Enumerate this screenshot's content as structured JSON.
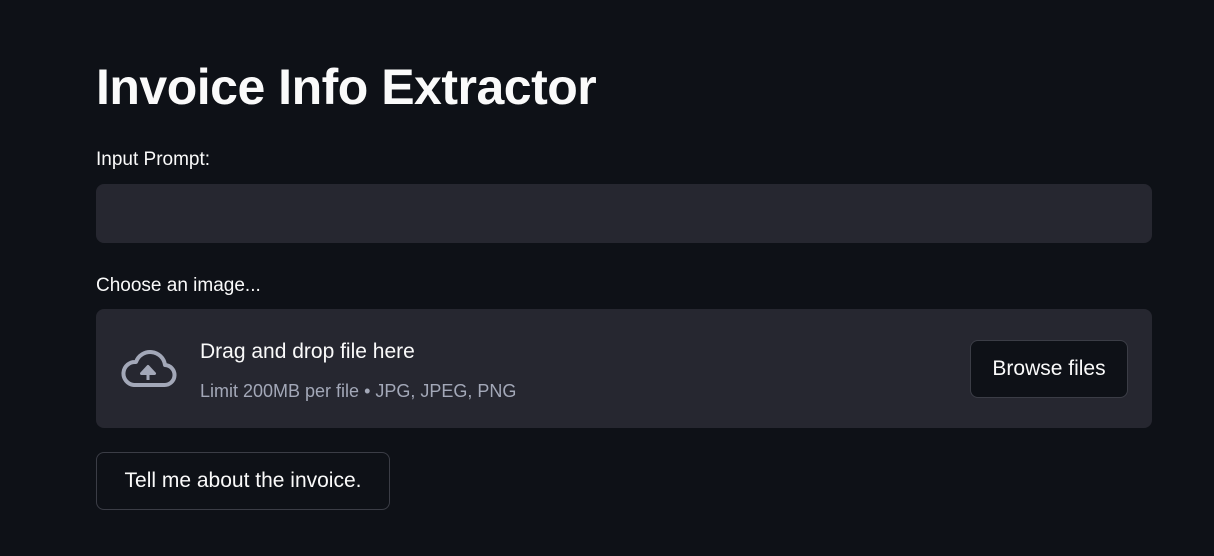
{
  "page": {
    "title": "Invoice Info Extractor"
  },
  "prompt_input": {
    "label": "Input Prompt:",
    "value": "",
    "placeholder": ""
  },
  "file_uploader": {
    "label": "Choose an image...",
    "icon": "cloud-upload-icon",
    "drop_text": "Drag and drop file here",
    "limit_text": "Limit 200MB per file • JPG, JPEG, PNG",
    "browse_label": "Browse files"
  },
  "submit": {
    "label": "Tell me about the invoice."
  },
  "colors": {
    "background": "#0e1117",
    "surface": "#262730",
    "text": "#fafafa",
    "muted_text": "#a3a8b8",
    "border": "#3b3d46"
  }
}
